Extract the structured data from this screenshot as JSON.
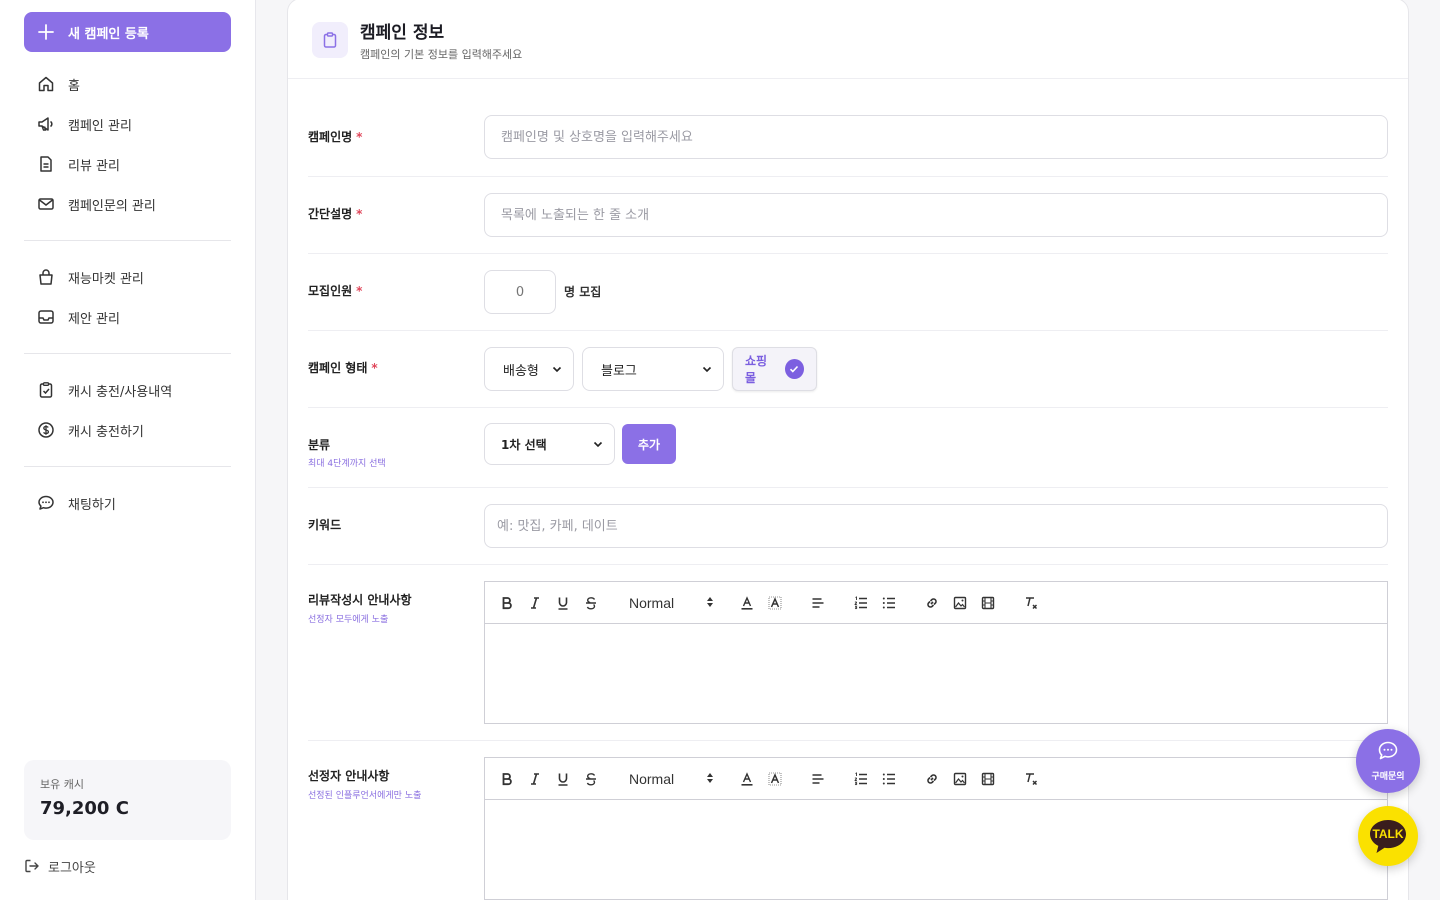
{
  "sidebar": {
    "new_campaign": "새 캠페인 등록",
    "group1": [
      {
        "label": "홈",
        "icon": "home-icon"
      },
      {
        "label": "캠페인 관리",
        "icon": "megaphone-icon"
      },
      {
        "label": "리뷰 관리",
        "icon": "document-icon"
      },
      {
        "label": "캠페인문의 관리",
        "icon": "mail-icon"
      }
    ],
    "group2": [
      {
        "label": "재능마켓 관리",
        "icon": "shopping-bag-icon"
      },
      {
        "label": "제안 관리",
        "icon": "inbox-icon"
      }
    ],
    "group3": [
      {
        "label": "캐시 충전/사용내역",
        "icon": "clipboard-check-icon"
      },
      {
        "label": "캐시 충전하기",
        "icon": "dollar-circle-icon"
      }
    ],
    "group4": [
      {
        "label": "채팅하기",
        "icon": "chat-icon"
      }
    ],
    "cash_label": "보유 캐시",
    "cash_value": "79,200 C",
    "logout": "로그아웃"
  },
  "card": {
    "title": "캠페인 정보",
    "subtitle": "캠페인의 기본 정보를 입력해주세요"
  },
  "form": {
    "name_label": "캠페인명",
    "name_placeholder": "캠페인명 및 상호명을 입력해주세요",
    "desc_label": "간단설명",
    "desc_placeholder": "목록에 노출되는 한 줄 소개",
    "recruit_label": "모집인원",
    "recruit_placeholder": "0",
    "recruit_suffix": "명 모집",
    "type_label": "캠페인 형태",
    "type_select1": "배송형",
    "type_select2": "블로그",
    "type_chip": "쇼핑몰",
    "category_label": "분류",
    "category_sub": "최대 4단계까지 선택",
    "category_select": "1차 선택",
    "category_add": "추가",
    "keyword_label": "키워드",
    "keyword_placeholder": "예: 맛집, 카페, 데이트",
    "review_label": "리뷰작성시 안내사항",
    "review_sub": "선정자 모두에게 노출",
    "selected_label": "선정자 안내사항",
    "selected_sub": "선정된 인플루언서에게만 노출",
    "required_mark": "*",
    "editor_size": "Normal"
  },
  "floating": {
    "chat_label": "구매문의",
    "talk_label": "TALK"
  },
  "colors": {
    "accent": "#8b70e6",
    "required": "#e0475b",
    "kakao": "#fae100"
  }
}
